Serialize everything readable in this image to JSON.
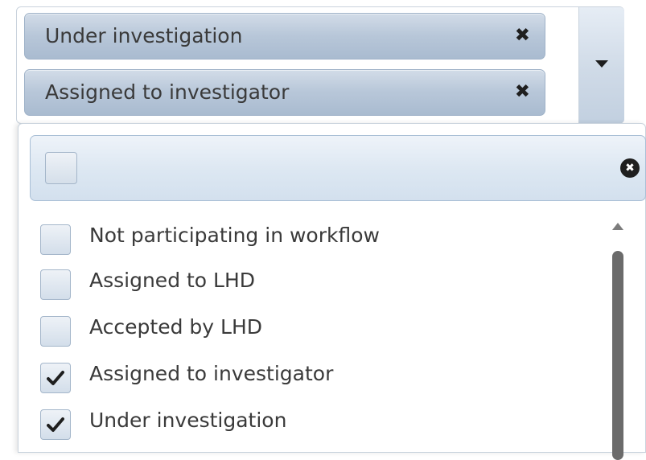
{
  "selected_chips": [
    {
      "label": "Under investigation",
      "remove": "✖"
    },
    {
      "label": "Assigned to investigator",
      "remove": "✖"
    }
  ],
  "dropdown_arrow": "chevron-down-icon",
  "search": {
    "value": "",
    "placeholder": "",
    "clear_icon": "✖"
  },
  "options": [
    {
      "label": "Not participating in workflow",
      "checked": false
    },
    {
      "label": "Assigned to LHD",
      "checked": false
    },
    {
      "label": "Accepted by LHD",
      "checked": false
    },
    {
      "label": "Assigned to investigator",
      "checked": true
    },
    {
      "label": "Under investigation",
      "checked": true
    }
  ],
  "colors": {
    "chip_bg": "#b8c7d9",
    "accent_border": "#a9bfd6",
    "text": "#3a3a3a"
  }
}
